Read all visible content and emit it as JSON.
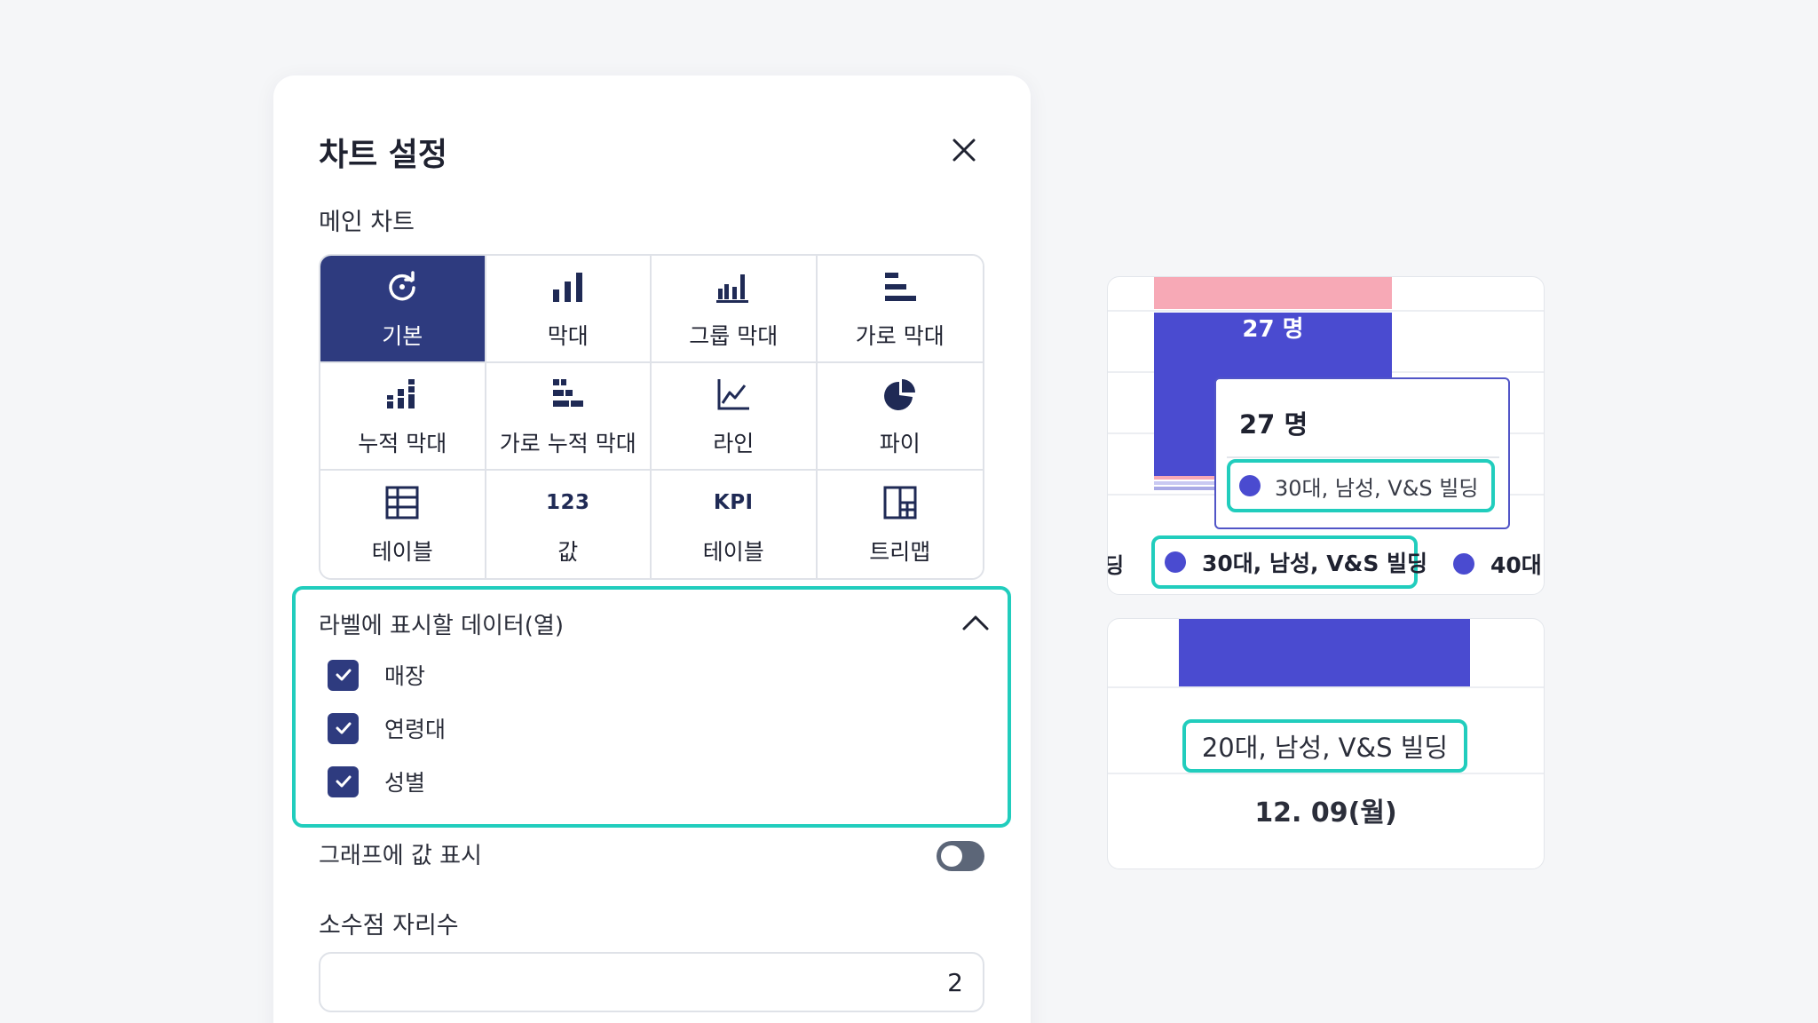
{
  "panel": {
    "title": "차트 설정",
    "main_chart_label": "메인 차트",
    "chart_types": [
      {
        "label": "기본",
        "icon": "refresh-icon",
        "active": true
      },
      {
        "label": "막대",
        "icon": "bar-chart-icon"
      },
      {
        "label": "그룹 막대",
        "icon": "grouped-bar-icon"
      },
      {
        "label": "가로 막대",
        "icon": "horizontal-bar-icon"
      },
      {
        "label": "누적 막대",
        "icon": "stacked-bar-icon"
      },
      {
        "label": "가로 누적 막대",
        "icon": "horizontal-stacked-bar-icon"
      },
      {
        "label": "라인",
        "icon": "line-chart-icon"
      },
      {
        "label": "파이",
        "icon": "pie-chart-icon"
      },
      {
        "label": "테이블",
        "icon": "table-icon"
      },
      {
        "label": "값",
        "icon": "value-icon",
        "icon_text": "123"
      },
      {
        "label": "테이블",
        "icon": "kpi-icon",
        "icon_text": "KPI"
      },
      {
        "label": "트리맵",
        "icon": "treemap-icon"
      }
    ],
    "label_data": {
      "title": "라벨에 표시할 데이터(열)",
      "options": [
        {
          "label": "매장",
          "checked": true
        },
        {
          "label": "연령대",
          "checked": true
        },
        {
          "label": "성별",
          "checked": true
        }
      ]
    },
    "show_values": {
      "label": "그래프에 값 표시",
      "enabled": false
    },
    "decimals": {
      "label": "소수점 자리수",
      "value": "2"
    }
  },
  "preview": {
    "bar_value_label": "27 명",
    "tooltip": {
      "value": "27 명",
      "series": "30대, 남성, V&S 빌딩"
    },
    "legend": {
      "fragment": "딩",
      "highlighted": "30대, 남성, V&S 빌딩",
      "next": "40대"
    },
    "category": "20대, 남성, V&S 빌딩",
    "date": "12. 09(월)"
  },
  "colors": {
    "accent": "#2e3b7f",
    "highlight": "#21cdbd",
    "series_blue": "#4a4bd0",
    "series_pink": "#f7a9b6"
  }
}
